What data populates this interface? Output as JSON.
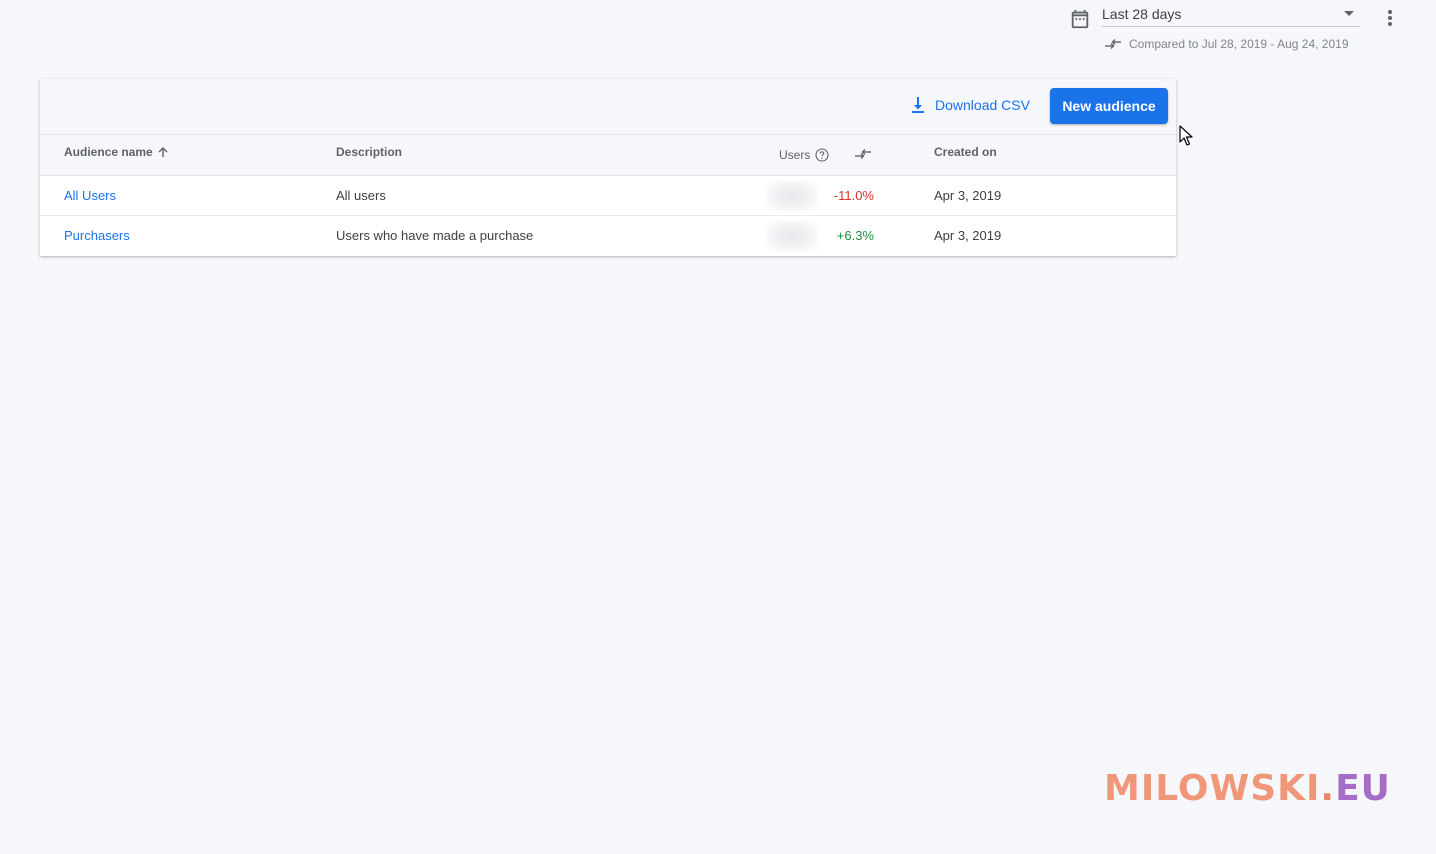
{
  "date_range": {
    "selected": "Last 28 days",
    "comparison": "Compared to Jul 28, 2019 - Aug 24, 2019"
  },
  "toolbar": {
    "download_label": "Download CSV",
    "new_audience_label": "New audience"
  },
  "table": {
    "headers": {
      "name": "Audience name",
      "description": "Description",
      "users": "Users",
      "created": "Created on"
    },
    "rows": [
      {
        "name": "All Users",
        "description": "All users",
        "change": "-11.0%",
        "created": "Apr 3, 2019"
      },
      {
        "name": "Purchasers",
        "description": "Users who have made a purchase",
        "change": "+6.3%",
        "created": "Apr 3, 2019"
      }
    ]
  },
  "watermark": {
    "main": "MILOWSKI",
    "dot": ".",
    "tld": "EU"
  },
  "colors": {
    "accent": "#1a73e8",
    "negative": "#d93025",
    "positive": "#1e8e3e"
  },
  "icons": [
    "calendar-icon",
    "compare-arrows-icon",
    "more-vert-icon",
    "download-icon",
    "sort-up-arrow-icon",
    "help-circle-icon",
    "mouse-cursor-icon"
  ]
}
